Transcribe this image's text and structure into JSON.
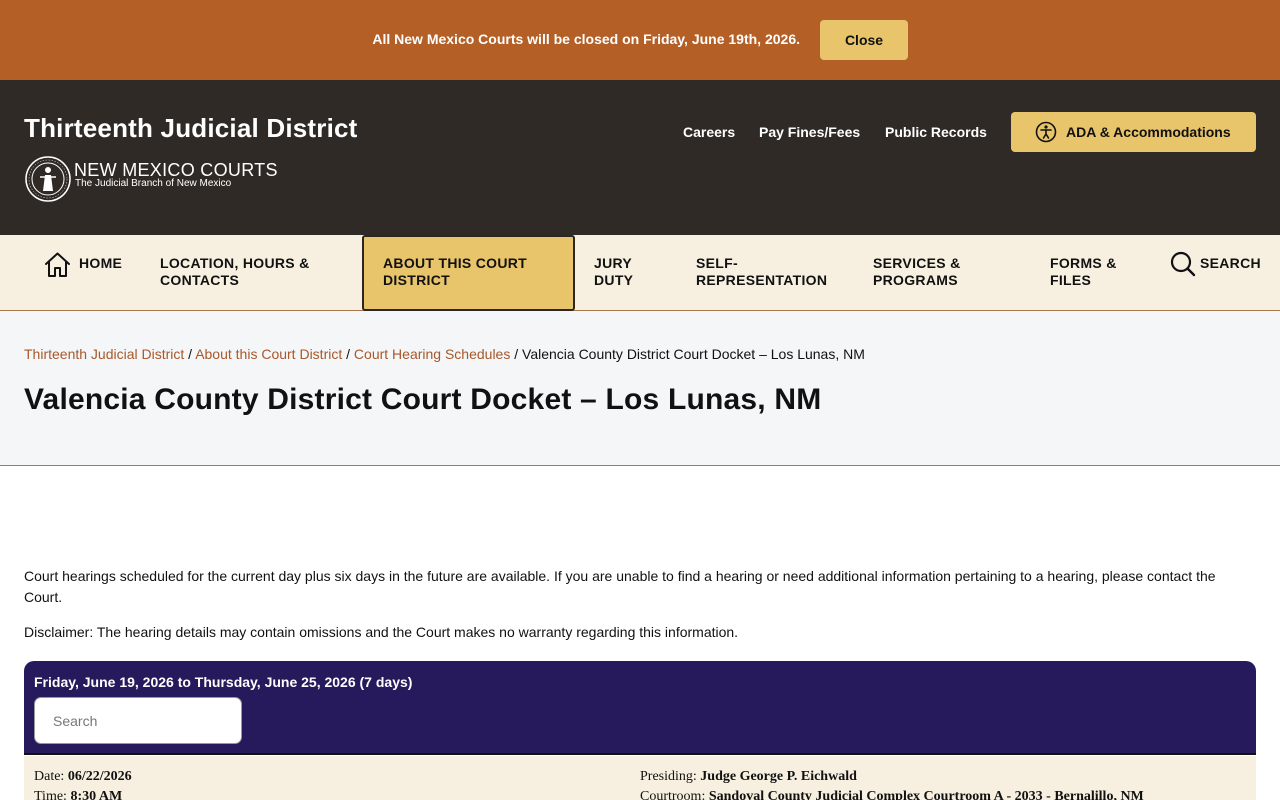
{
  "alert": {
    "text": "All New Mexico Courts will be closed on Friday, June 19th, 2026.",
    "close_label": "Close"
  },
  "header": {
    "site_title": "Thirteenth Judicial District",
    "brand_name": "NEW MEXICO COURTS",
    "brand_subtitle": "The Judicial Branch of New Mexico",
    "utility_links": [
      "Careers",
      "Pay Fines/Fees",
      "Public Records"
    ],
    "ada_label": "ADA & Accommodations"
  },
  "nav": {
    "home": "HOME",
    "location_line1": "LOCATION, HOURS &",
    "location_line2": "CONTACTS",
    "about_line1": "ABOUT THIS COURT",
    "about_line2": "DISTRICT",
    "jury_line1": "JURY",
    "jury_line2": "DUTY",
    "self_line1": "SELF-",
    "self_line2": "REPRESENTATION",
    "services_line1": "SERVICES &",
    "services_line2": "PROGRAMS",
    "forms_line1": "FORMS &",
    "forms_line2": "FILES",
    "search": "SEARCH"
  },
  "breadcrumb": {
    "items": [
      "Thirteenth Judicial District",
      "About this Court District",
      "Court Hearing Schedules"
    ],
    "current": "Valencia County District Court Docket – Los Lunas, NM",
    "separator": " / "
  },
  "page": {
    "title": "Valencia County District Court Docket – Los Lunas, NM",
    "intro": "Court hearings scheduled for the current day plus six days in the future are available. If you are unable to find a hearing or need additional information pertaining to a hearing, please contact the Court.",
    "disclaimer": "Disclaimer:  The hearing details may contain omissions and the Court makes no warranty regarding this information."
  },
  "docket": {
    "range": "Friday, June 19, 2026 to Thursday, June 25, 2026 (7 days)",
    "search_placeholder": "Search",
    "hearing": {
      "date_label": "Date: ",
      "date": "06/22/2026",
      "time_label": "Time: ",
      "time": "8:30 AM",
      "presiding_label": "Presiding: ",
      "presiding": "Judge George P. Eichwald",
      "courtroom_label": "Courtroom: ",
      "courtroom": "Sandoval County Judicial Complex Courtroom A - 2033 - Bernalillo, NM"
    }
  },
  "colors": {
    "alert_bg": "#b45f26",
    "accent_gold": "#e8c46a",
    "header_bg": "#302a26",
    "nav_bg": "#f7f0e1",
    "docket_bg": "#261a5c",
    "link": "#a8582a"
  }
}
